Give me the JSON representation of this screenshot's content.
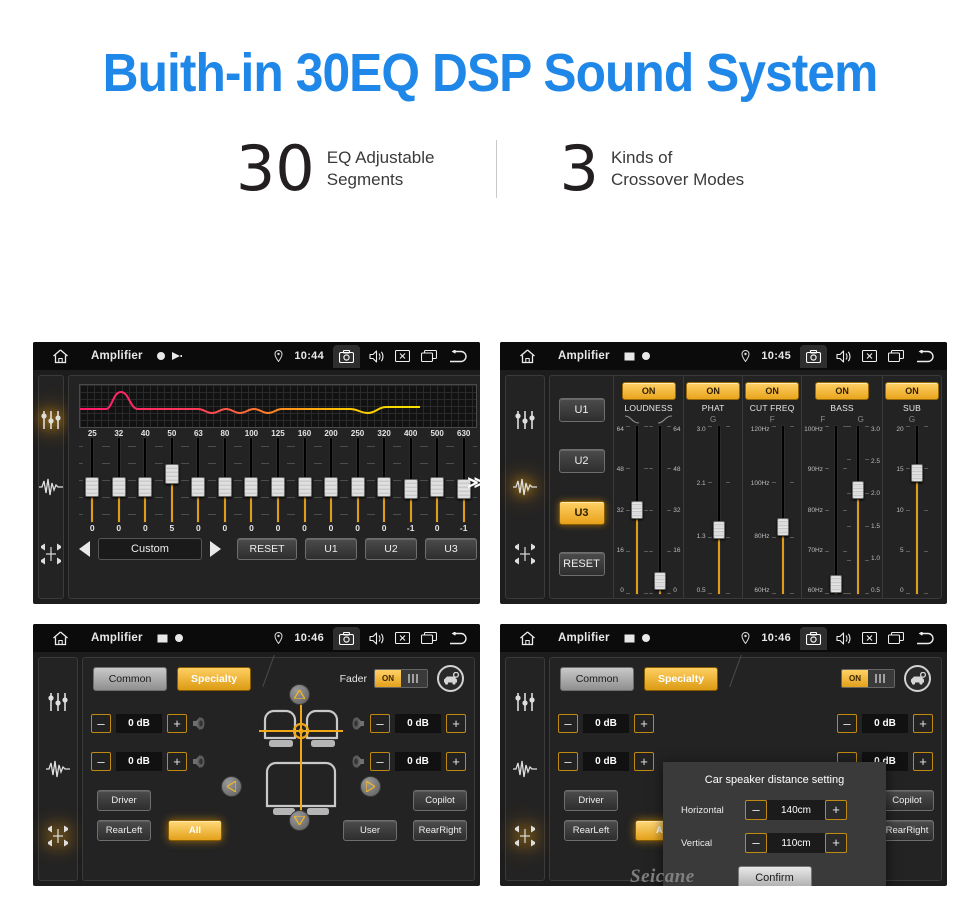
{
  "header": {
    "title": "Buith-in 30EQ DSP Sound System",
    "title_color": "#1f87e8",
    "stats": [
      {
        "number": "30",
        "line1": "EQ Adjustable",
        "line2": "Segments"
      },
      {
        "number": "3",
        "line1": "Kinds of",
        "line2": "Crossover Modes"
      }
    ]
  },
  "colors": {
    "accent_orange": "#e3a01b",
    "screen_bg": "#1d1d1d",
    "panel_bg": "#232323",
    "statusbar_bg": "#0b0b0b"
  },
  "statusbar": {
    "app_title": "Amplifier",
    "icons": [
      "home-icon",
      "image-icon",
      "record-icon",
      "play-icon",
      "location-pin-icon",
      "camera-icon",
      "volume-icon",
      "close-icon",
      "recents-icon",
      "back-icon"
    ]
  },
  "panel_eq": {
    "time": "10:44",
    "title": "Amplifier",
    "rail_icons": [
      "eq-sliders-icon",
      "waveform-icon",
      "balance-icon"
    ],
    "rail_active_index": 0,
    "preset_label": "Custom",
    "reset_label": "RESET",
    "user_presets": [
      "U1",
      "U2",
      "U3"
    ],
    "more_chevron": "≫",
    "frequencies": [
      "25",
      "32",
      "40",
      "50",
      "63",
      "80",
      "100",
      "125",
      "160",
      "200",
      "250",
      "320",
      "400",
      "500",
      "630"
    ],
    "values": [
      "0",
      "0",
      "0",
      "5",
      "0",
      "0",
      "0",
      "0",
      "0",
      "0",
      "0",
      "0",
      "-1",
      "0",
      "-1"
    ]
  },
  "panel_crossover": {
    "time": "10:45",
    "title": "Amplifier",
    "rail_active_index": 1,
    "preset_chip": "U1",
    "presets": [
      "U1",
      "U2",
      "U3"
    ],
    "selected_preset": "U3",
    "reset_label": "RESET",
    "sections": [
      {
        "name": "LOUDNESS",
        "toggle": "ON",
        "sub": [
          "curve-low-icon",
          "curve-high-icon"
        ],
        "sliders": [
          {
            "scale": [
              "64",
              "48",
              "32",
              "16",
              "0"
            ],
            "value_pct": 50
          },
          {
            "scale": [
              "64",
              "48",
              "32",
              "16",
              "0"
            ],
            "value_pct": 8
          }
        ]
      },
      {
        "name": "PHAT",
        "toggle": "ON",
        "sub": [
          "G"
        ],
        "sliders": [
          {
            "scale": [
              "3.0",
              "2.1",
              "1.3",
              "0.5"
            ],
            "value_pct": 38
          }
        ]
      },
      {
        "name": "CUT FREQ",
        "toggle": "ON",
        "sub": [
          "F"
        ],
        "sliders": [
          {
            "scale": [
              "120Hz",
              "100Hz",
              "80Hz",
              "60Hz"
            ],
            "value_pct": 40
          }
        ]
      },
      {
        "name": "BASS",
        "toggle": "ON",
        "sub": [
          "F",
          "G"
        ],
        "sliders": [
          {
            "scale": [
              "100Hz",
              "90Hz",
              "80Hz",
              "70Hz",
              "60Hz"
            ],
            "value_pct": 6
          },
          {
            "scale": [
              "3.0",
              "2.5",
              "2.0",
              "1.5",
              "1.0",
              "0.5"
            ],
            "value_pct": 62
          }
        ]
      },
      {
        "name": "SUB",
        "toggle": "ON",
        "sub": [
          "G"
        ],
        "sliders": [
          {
            "scale": [
              "20",
              "15",
              "10",
              "5",
              "0"
            ],
            "value_pct": 72
          }
        ]
      }
    ]
  },
  "panel_fader": {
    "time": "10:46",
    "title": "Amplifier",
    "rail_active_index": 2,
    "tabs": [
      {
        "label": "Common",
        "selected": false
      },
      {
        "label": "Specialty",
        "selected": true
      }
    ],
    "fader_label": "Fader",
    "fader_toggle": "ON",
    "gear_icon": "car-speaker-settings-icon",
    "db_controls": [
      {
        "position": "front-left",
        "value": "0 dB"
      },
      {
        "position": "rear-left",
        "value": "0 dB"
      },
      {
        "position": "front-right",
        "value": "0 dB"
      },
      {
        "position": "rear-right",
        "value": "0 dB"
      }
    ],
    "minus": "–",
    "plus": "+",
    "seat_buttons": [
      {
        "label": "Driver",
        "selected": false
      },
      {
        "label": "RearLeft",
        "selected": false
      },
      {
        "label": "All",
        "selected": true
      },
      {
        "label": "User",
        "selected": false
      },
      {
        "label": "Copilot",
        "selected": false
      },
      {
        "label": "RearRight",
        "selected": false
      }
    ]
  },
  "panel_dialog": {
    "time": "10:46",
    "title": "Amplifier",
    "rail_active_index": 2,
    "dialog": {
      "title": "Car speaker distance setting",
      "rows": [
        {
          "label": "Horizontal",
          "value": "140cm"
        },
        {
          "label": "Vertical",
          "value": "110cm"
        }
      ],
      "minus": "–",
      "plus": "+",
      "confirm": "Confirm"
    },
    "watermark": "Seicane"
  }
}
